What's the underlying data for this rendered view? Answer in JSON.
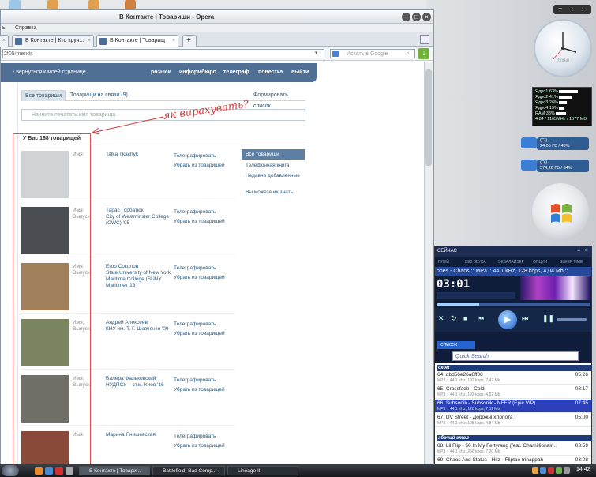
{
  "browser": {
    "title": "В Контакте | Товарищи - Opera",
    "menu": [
      "Справка"
    ],
    "tabs": [
      {
        "label": "В Контакте | Кто круч..."
      },
      {
        "label": "В Контакте | Товарищ"
      }
    ],
    "url": "http://vkontakte.ru/friends",
    "url_display": "2f05/friends",
    "search_placeholder": "Искать в Google"
  },
  "vk": {
    "back": "вернуться к моей странице",
    "nav": [
      "розыск",
      "информбюро",
      "телеграф",
      "повестка",
      "выйти"
    ],
    "tabs": [
      "Все товарищи",
      "Товарищи на связи (9)"
    ],
    "tab_right": "Формировать список",
    "search_placeholder": "Начните печатать имя товарища",
    "count": "У Вас 168 товарищей",
    "label_name": "Имя:",
    "label_study": "Выпуск:",
    "action_send": "Телеграфировать",
    "action_remove": "Убрать из товарищей",
    "friends": [
      {
        "name": "Talka Tkachyk",
        "study": ""
      },
      {
        "name": "Тарас Горбатюк",
        "study": "City of Westminster College (CWC) '05"
      },
      {
        "name": "Егор Соколов",
        "study": "State University of New York Maritime College (SUNY Maritime) '13"
      },
      {
        "name": "Андрей Алексеев",
        "study": "КНУ им. Т. Г. Шевченко '09"
      },
      {
        "name": "Валера Фальковский",
        "study": "НУДПСУ – ст.м. Киев '16"
      },
      {
        "name": "Марина Янишевская",
        "study": ""
      }
    ],
    "right_menu": [
      "Все товарищи",
      "Телефонная книга",
      "Недавно добавленные",
      "Вы можете их знать"
    ],
    "annotation": "як вирахувать?"
  },
  "gadgets": {
    "clock_label": "Кухня",
    "cpu": [
      {
        "label": "Ядро1",
        "value": "63%"
      },
      {
        "label": "Ядро2",
        "value": "41%"
      },
      {
        "label": "Ядро3",
        "value": "26%"
      },
      {
        "label": "Ядро4",
        "value": "15%"
      },
      {
        "label": "RAM",
        "value": "33%"
      }
    ],
    "cpu_footer": "4:84 / 1105MHz / 1577 MB",
    "drives": [
      {
        "letter": "(C:)",
        "info": "24,05 ГБ / 48%"
      },
      {
        "letter": "(D:)",
        "info": "574,26 ГБ / 64%"
      }
    ]
  },
  "player": {
    "title": "СЕЙЧАС",
    "menu": [
      "ПЛЕЙ",
      "БЕЗ ЗВУКА",
      "ЭКВАЛАЙЗЕР",
      "ОПЦИИ",
      "SLEEP TIME"
    ],
    "info": "ones - Chaos :: MP3 :: 44,1 kHz, 128 kbps, 4,04 Mb ::",
    "time": "03:01",
    "playlist_tab": "СПИСОК",
    "search_placeholder": "Quick Search",
    "groups": [
      "ском",
      "абочий стол"
    ],
    "tracks": [
      {
        "title": "64. dbd56e26a8ff08",
        "meta": "MP3 :: 44,1 kHz, 192 kbps, 7,47 Mb",
        "dur": "05:26"
      },
      {
        "title": "65. Crossfade - Cold",
        "meta": "MP3 :: 44,1 kHz, 192 kbps, 4,52 Mb",
        "dur": "03:17"
      },
      {
        "title": "66. Subsonik - Subsonik - NFFR (Epic VIP)",
        "meta": "MP3 :: 44,1 kHz, 128 kbps, 7,11 Mb",
        "dur": "07:45"
      },
      {
        "title": "67. DV Street - Дорожні хлопота",
        "meta": "MP3 :: 44,1 kHz, 128 kbps, 4,84 Mb",
        "dur": "05:00"
      },
      {
        "title": "68. Lil Flip - 50 In My Fertyrang (feat. Chamillionair...",
        "meta": "MP3 :: 44,1 kHz, 256 kbps, 7,20 Mb",
        "dur": "03:59"
      },
      {
        "title": "69. Chaos And Status - Hitz - Fliptae trinappah",
        "meta": "",
        "dur": "03:08"
      }
    ]
  },
  "taskbar": {
    "tasks": [
      "В Контакте | Товари...",
      "Battlefield: Bad Comp...",
      "Lineage II"
    ],
    "clock": "14:42"
  }
}
